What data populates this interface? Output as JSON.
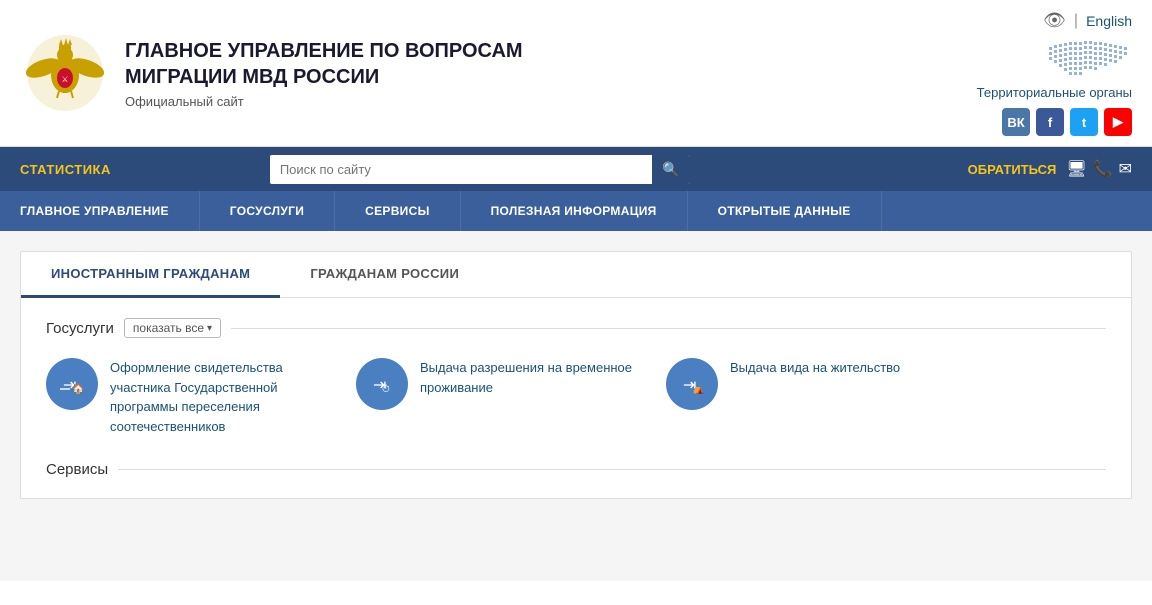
{
  "header": {
    "title_line1": "ГЛАВНОЕ УПРАВЛЕНИЕ ПО ВОПРОСАМ",
    "title_line2": "МИГРАЦИИ МВД РОССИИ",
    "subtitle": "Официальный сайт",
    "lang": "English",
    "territorial_link": "Территориальные органы"
  },
  "nav": {
    "stats_label": "СТАТИСТИКА",
    "search_placeholder": "Поиск по сайту",
    "contact_label": "ОБРАТИТЬСЯ"
  },
  "secondary_nav": {
    "items": [
      "ГЛАВНОЕ УПРАВЛЕНИЕ",
      "ГОСУСЛУГИ",
      "СЕРВИСЫ",
      "ПОЛЕЗНАЯ ИНФОРМАЦИЯ",
      "ОТКРЫТЫЕ ДАННЫЕ"
    ]
  },
  "tabs": [
    {
      "id": "foreign",
      "label": "ИНОСТРАННЫМ ГРАЖДАНАМ",
      "active": true
    },
    {
      "id": "russia",
      "label": "ГРАЖДАНАМ РОССИИ",
      "active": false
    }
  ],
  "gosuslugi": {
    "section_title": "Госуслуги",
    "show_all": "показать все",
    "services": [
      {
        "text": "Оформление свидетельства участника Государственной программы переселения соотечественников"
      },
      {
        "text": "Выдача разрешения на временное проживание"
      },
      {
        "text": "Выдача вида на жительство"
      }
    ]
  },
  "servisy": {
    "section_title": "Сервисы"
  },
  "social": {
    "vk": "ВК",
    "fb": "f",
    "tw": "t",
    "yt": "▶"
  }
}
